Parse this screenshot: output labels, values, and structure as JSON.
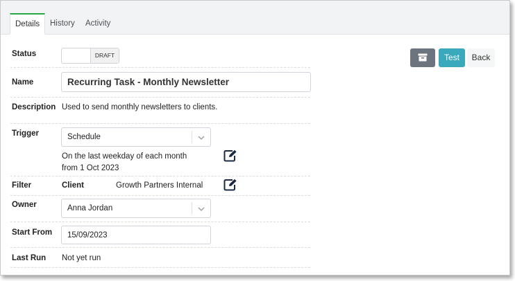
{
  "tabs": [
    {
      "label": "Details"
    },
    {
      "label": "History"
    },
    {
      "label": "Activity"
    }
  ],
  "status": {
    "label": "Status",
    "value": "DRAFT"
  },
  "name": {
    "label": "Name",
    "value": "Recurring Task - Monthly Newsletter"
  },
  "description": {
    "label": "Description",
    "value": "Used to send monthly newsletters to clients."
  },
  "trigger": {
    "label": "Trigger",
    "selected": "Schedule",
    "summary_line1": "On the last weekday of each month",
    "summary_line2": "from 1 Oct 2023"
  },
  "filter": {
    "label": "Filter",
    "key": "Client",
    "value": "Growth Partners Internal"
  },
  "owner": {
    "label": "Owner",
    "selected": "Anna Jordan"
  },
  "start_from": {
    "label": "Start From",
    "value": "15/09/2023"
  },
  "last_run": {
    "label": "Last Run",
    "value": "Not yet run"
  },
  "actions": {
    "test_label": "Test",
    "back_label": "Back"
  },
  "colors": {
    "accent_tab": "#28a745",
    "test_button": "#3aa9bd",
    "archive_button": "#6c757d"
  }
}
